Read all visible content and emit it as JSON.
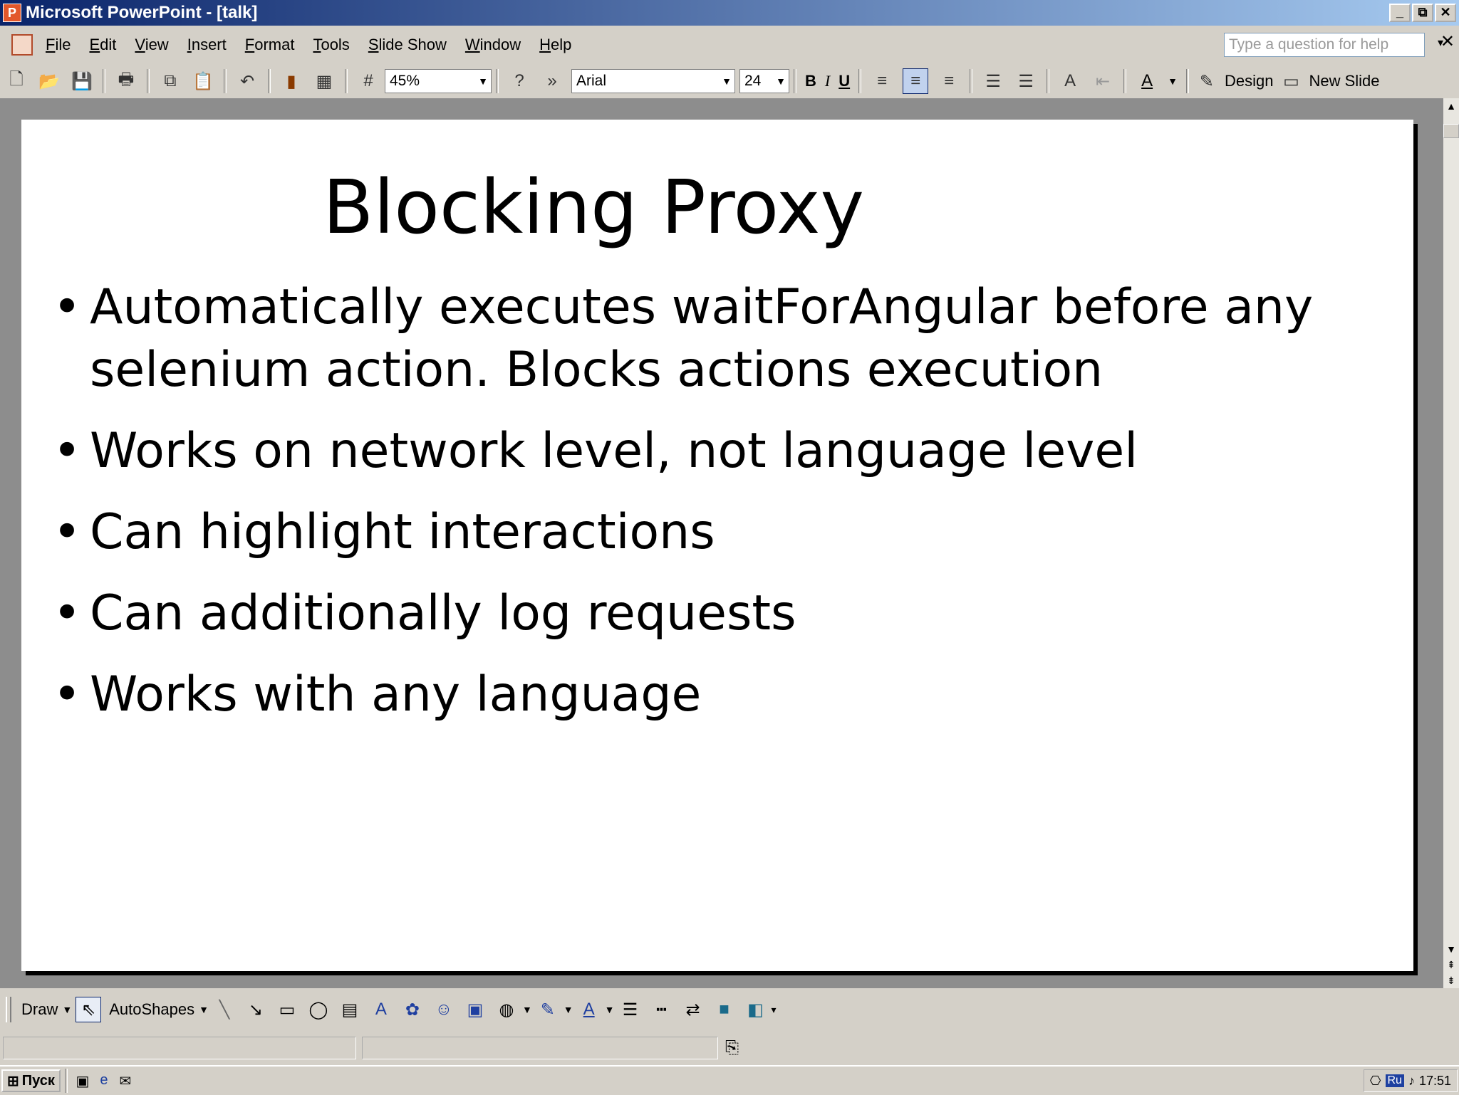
{
  "window": {
    "title": "Microsoft PowerPoint - [talk]",
    "controls": [
      "_",
      "⧉",
      "✕"
    ]
  },
  "menubar": {
    "items": [
      "File",
      "Edit",
      "View",
      "Insert",
      "Format",
      "Tools",
      "Slide Show",
      "Window",
      "Help"
    ],
    "help_placeholder": "Type a question for help"
  },
  "toolbar": {
    "zoom": "45%",
    "font": "Arial",
    "font_size": "24",
    "bold": "B",
    "italic": "I",
    "underline": "U",
    "design_label": "Design",
    "new_slide_label": "New Slide"
  },
  "slide": {
    "title": "Blocking Proxy",
    "bullets": [
      "Automatically executes waitForAngular before any selenium action. Blocks actions execution",
      "Works on network level, not language level",
      "Can highlight interactions",
      "Can additionally log requests",
      "Works with any language"
    ]
  },
  "drawbar": {
    "draw_label": "Draw",
    "autoshapes_label": "AutoShapes"
  },
  "taskbar": {
    "start_label": "Пуск",
    "lang": "Ru",
    "clock": "17:51"
  }
}
